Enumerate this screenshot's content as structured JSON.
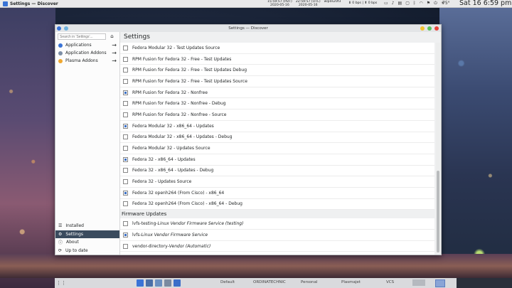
{
  "top_panel": {
    "app_title": "Settings — Discover",
    "clock": [
      {
        "time": "15:59:57",
        "tz": "(PDT)",
        "date": "2020-05-16"
      },
      {
        "time": "22:59:57",
        "tz": "(UTC)",
        "date": "2020-05-16"
      },
      {
        "time": "",
        "tz": "",
        "date": "wlp0s20f3"
      }
    ],
    "net_speed": "⬇ 0 bps | ⬆ 0 bps",
    "temperature": "75°",
    "date_time": "Sat 16   6:59 pm"
  },
  "window": {
    "title": "Settings — Discover",
    "search_placeholder": "Search in 'Settings'...",
    "sidebar_top": [
      {
        "label": "Applications",
        "color": "#3a73d6"
      },
      {
        "label": "Application Addons",
        "color": "#7c8ea6"
      },
      {
        "label": "Plasma Addons",
        "color": "#f0a830"
      }
    ],
    "sidebar_bottom": [
      {
        "label": "Installed",
        "icon": "list-icon"
      },
      {
        "label": "Settings",
        "icon": "gear-icon"
      },
      {
        "label": "About",
        "icon": "info-icon"
      },
      {
        "label": "Up to date",
        "icon": "update-icon"
      }
    ],
    "active_bottom": "Settings",
    "page_title": "Settings",
    "repos": [
      {
        "label": "Fedora Modular 32 - Test Updates Source",
        "checked": false
      },
      {
        "label": "RPM Fusion for Fedora 32 - Free - Test Updates",
        "checked": false
      },
      {
        "label": "RPM Fusion for Fedora 32 - Free - Test Updates Debug",
        "checked": false
      },
      {
        "label": "RPM Fusion for Fedora 32 - Free - Test Updates Source",
        "checked": false
      },
      {
        "label": "RPM Fusion for Fedora 32 - Nonfree",
        "checked": true
      },
      {
        "label": "RPM Fusion for Fedora 32 - Nonfree - Debug",
        "checked": false
      },
      {
        "label": "RPM Fusion for Fedora 32 - Nonfree - Source",
        "checked": false
      },
      {
        "label": "Fedora Modular 32 - x86_64 - Updates",
        "checked": true
      },
      {
        "label": "Fedora Modular 32 - x86_64 - Updates - Debug",
        "checked": false
      },
      {
        "label": "Fedora Modular 32 - Updates Source",
        "checked": false
      },
      {
        "label": "Fedora 32 - x86_64 - Updates",
        "checked": true
      },
      {
        "label": "Fedora 32 - x86_64 - Updates - Debug",
        "checked": false
      },
      {
        "label": "Fedora 32 - Updates Source",
        "checked": false
      },
      {
        "label": "Fedora 32 openh264 (From Cisco) - x86_64",
        "checked": true
      },
      {
        "label": "Fedora 32 openh264 (From Cisco) - x86_64 - Debug",
        "checked": false
      }
    ],
    "firmware_section": "Firmware Updates",
    "firmware": [
      {
        "name": "lvfs-testing",
        "desc": "Linux Vendor Firmware Service (testing)",
        "checked": false
      },
      {
        "name": "lvfs",
        "desc": "Linux Vendor Firmware Service",
        "checked": true
      },
      {
        "name": "vendor-directory",
        "desc": "Vendor (Automatic)",
        "checked": false
      }
    ]
  },
  "taskbar": {
    "desktops": [
      "Default",
      "ORDINATECHNIC",
      "Personal",
      "Plasmajet",
      "VCS"
    ]
  }
}
